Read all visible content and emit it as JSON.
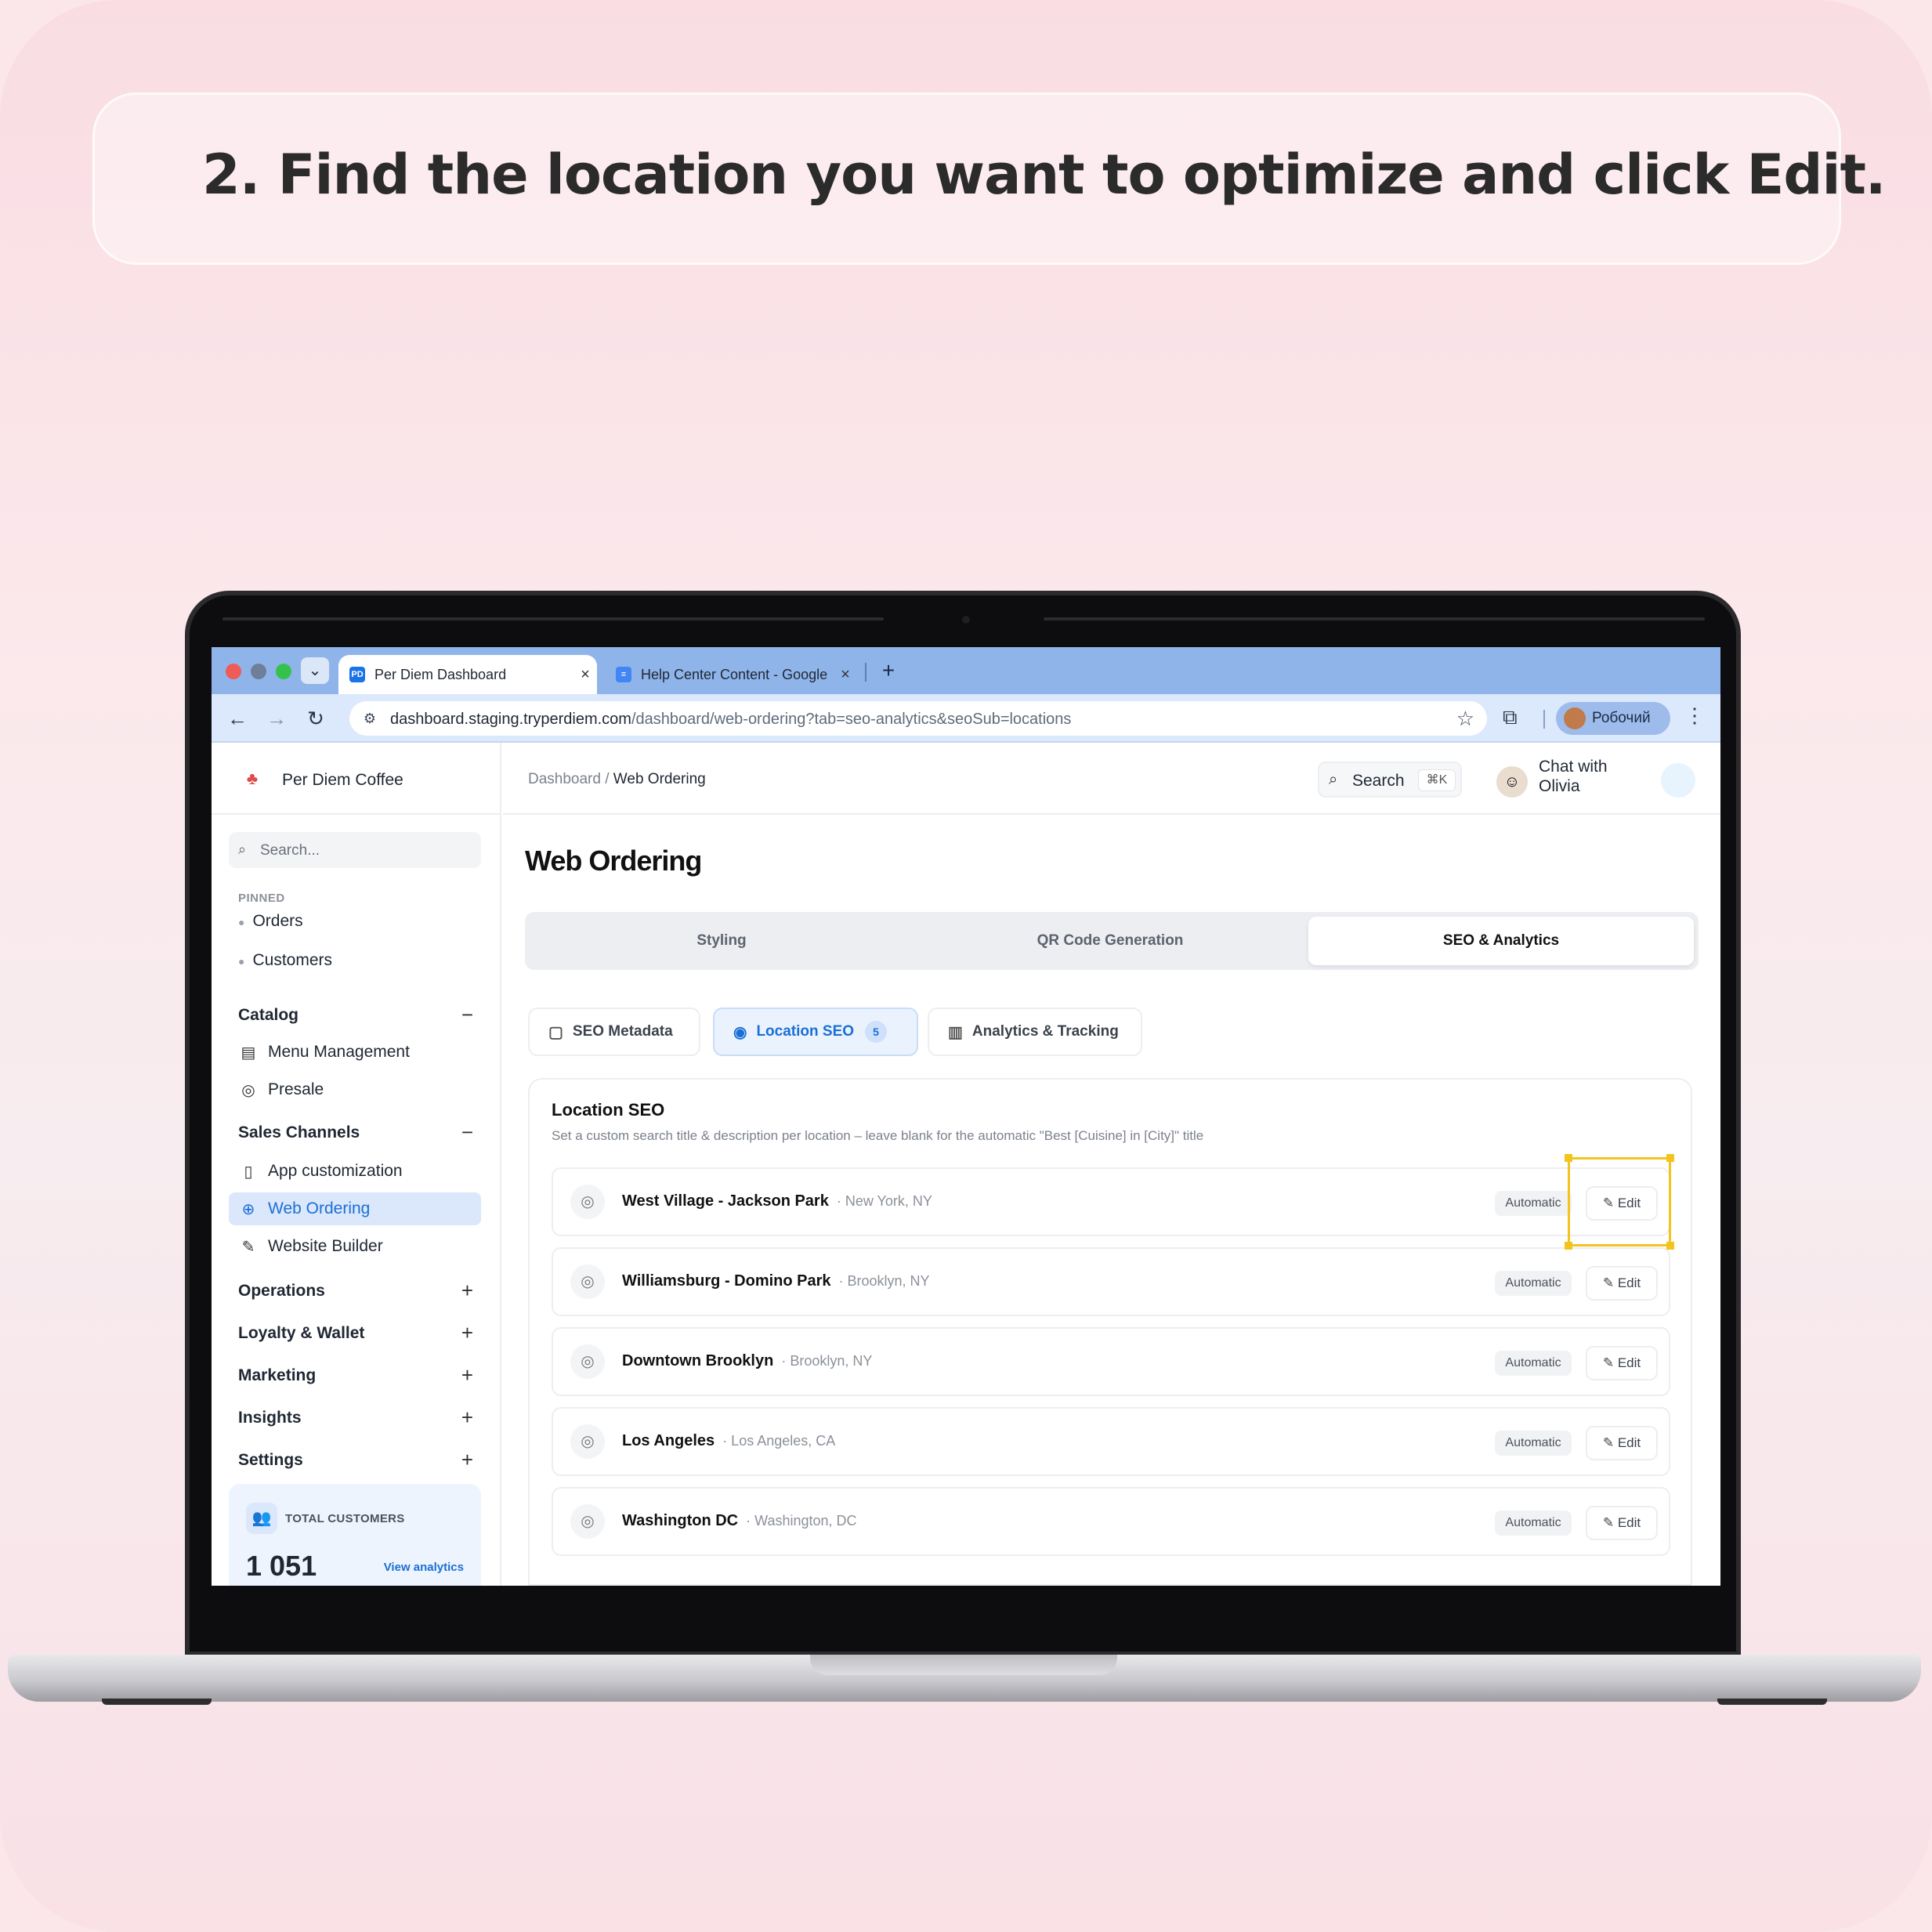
{
  "caption": "2. Find the location you want to optimize and click Edit.",
  "browser": {
    "tabs": [
      {
        "label": "Per Diem Dashboard",
        "favicon": "PD",
        "active": true
      },
      {
        "label": "Help Center Content - Google",
        "favicon": "doc",
        "active": false
      }
    ],
    "url_host": "dashboard.staging.tryperdiem.com",
    "url_path": "/dashboard/web-ordering?tab=seo-analytics&seoSub=locations",
    "profile_name": "Робочий"
  },
  "sidebar": {
    "brand_name": "Per Diem Coffee",
    "search_placeholder": "Search...",
    "pinned_label": "PINNED",
    "pinned": [
      "Orders",
      "Customers"
    ],
    "catalog": {
      "label": "Catalog",
      "items": [
        "Menu Management",
        "Presale"
      ]
    },
    "sales_channels": {
      "label": "Sales Channels",
      "items": [
        "App customization",
        "Web Ordering",
        "Website Builder"
      ]
    },
    "sections": [
      "Operations",
      "Loyalty & Wallet",
      "Marketing",
      "Insights",
      "Settings"
    ],
    "total_customers_label": "TOTAL CUSTOMERS",
    "total_customers_value": "1 051",
    "view_analytics": "View analytics"
  },
  "topbar": {
    "crumb_root": "Dashboard",
    "crumb_sep": "/",
    "crumb_current": "Web Ordering",
    "search_label": "Search",
    "search_kbd": "⌘K",
    "chat_label": "Chat with Olivia"
  },
  "main": {
    "title": "Web Ordering",
    "tabs": [
      "Styling",
      "QR Code Generation",
      "SEO & Analytics"
    ],
    "subtabs": {
      "seo_metadata": "SEO Metadata",
      "location_seo": "Location SEO",
      "location_count": "5",
      "analytics": "Analytics & Tracking"
    },
    "location_seo": {
      "title": "Location SEO",
      "description": "Set a custom search title & description per location – leave blank for the automatic \"Best [Cuisine] in [City]\" title",
      "status_label": "Automatic",
      "edit_label": "Edit",
      "locations": [
        {
          "name": "West Village - Jackson Park",
          "city": "· New York, NY"
        },
        {
          "name": "Williamsburg - Domino Park",
          "city": "· Brooklyn, NY"
        },
        {
          "name": "Downtown Brooklyn",
          "city": "· Brooklyn, NY"
        },
        {
          "name": "Los Angeles",
          "city": "· Los Angeles, CA"
        },
        {
          "name": "Washington DC",
          "city": "· Washington, DC"
        }
      ]
    }
  },
  "colors": {
    "accent": "#1a6fd6",
    "highlight": "#f2c41d",
    "tabbar": "#8fb4ea"
  }
}
